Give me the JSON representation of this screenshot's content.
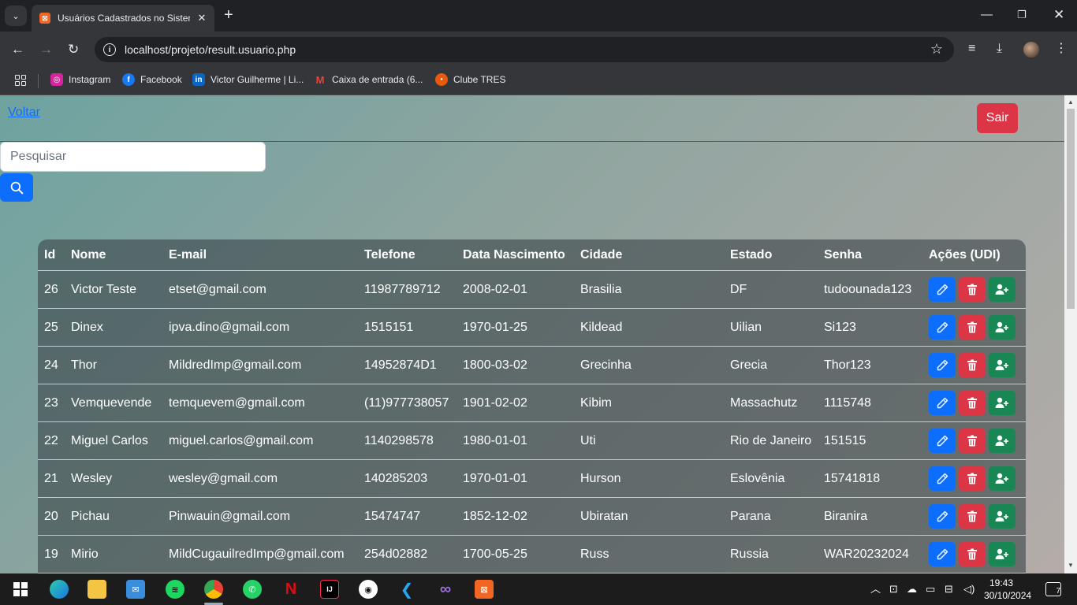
{
  "browser": {
    "tab_title": "Usuários Cadastrados no Sistema",
    "url": "localhost/projeto/result.usuario.php",
    "bookmarks": [
      {
        "label": "Instagram",
        "icon": "instagram-icon",
        "color": "#d6249f"
      },
      {
        "label": "Facebook",
        "icon": "facebook-icon",
        "color": "#1877f2"
      },
      {
        "label": "Victor Guilherme | Li...",
        "icon": "linkedin-icon",
        "color": "#0a66c2"
      },
      {
        "label": "Caixa de entrada (6...",
        "icon": "gmail-icon",
        "color": "#ea4335"
      },
      {
        "label": "Clube TRES",
        "icon": "clube-tres-icon",
        "color": "#e8590c"
      }
    ]
  },
  "page": {
    "back_link": "Voltar",
    "logout_button": "Sair",
    "search_placeholder": "Pesquisar",
    "colors": {
      "primary": "#0d6efd",
      "danger": "#dc3545",
      "success": "#198754"
    }
  },
  "table": {
    "headers": [
      "Id",
      "Nome",
      "E-mail",
      "Telefone",
      "Data Nascimento",
      "Cidade",
      "Estado",
      "Senha",
      "Ações (UDI)"
    ],
    "rows": [
      [
        "26",
        "Victor Teste",
        "etset@gmail.com",
        "11987789712",
        "2008-02-01",
        "Brasilia",
        "DF",
        "tudoounada123"
      ],
      [
        "25",
        "Dinex",
        "ipva.dino@gmail.com",
        "1515151",
        "1970-01-25",
        "Kildead",
        "Uilian",
        "Si123"
      ],
      [
        "24",
        "Thor",
        "MildredImp@gmail.com",
        "14952874D1",
        "1800-03-02",
        "Grecinha",
        "Grecia",
        "Thor123"
      ],
      [
        "23",
        "Vemquevende",
        "temquevem@gmail.com",
        "(11)977738057",
        "1901-02-02",
        "Kibim",
        "Massachutz",
        "1115748"
      ],
      [
        "22",
        "Miguel Carlos",
        "miguel.carlos@gmail.com",
        "1140298578",
        "1980-01-01",
        "Uti",
        "Rio de Janeiro",
        "151515"
      ],
      [
        "21",
        "Wesley",
        "wesley@gmail.com",
        "140285203",
        "1970-01-01",
        "Hurson",
        "Eslovênia",
        "15741818"
      ],
      [
        "20",
        "Pichau",
        "Pinwauin@gmail.com",
        "15474747",
        "1852-12-02",
        "Ubiratan",
        "Parana",
        "Biranira"
      ],
      [
        "19",
        "Mirio",
        "MildCugauilredImp@gmail.com",
        "254d02882",
        "1700-05-25",
        "Russ",
        "Russia",
        "WAR20232024"
      ]
    ]
  },
  "taskbar": {
    "time": "19:43",
    "date": "30/10/2024",
    "notifications": "7"
  }
}
